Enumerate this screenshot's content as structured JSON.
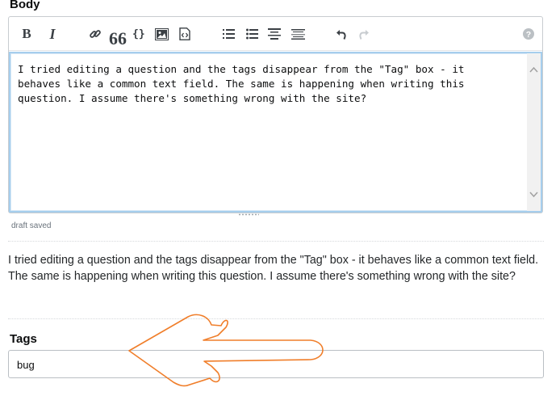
{
  "body_label": "Body",
  "toolbar": {
    "bold_label": "B",
    "italic_label": "I",
    "quote_label": "66",
    "code_label": "{}",
    "icons": [
      "bold-icon",
      "italic-icon",
      "link-icon",
      "blockquote-icon",
      "code-icon",
      "image-icon",
      "snippet-icon",
      "ordered-list-icon",
      "bulleted-list-icon",
      "heading-icon",
      "horizontal-rule-icon",
      "undo-icon",
      "redo-icon",
      "help-icon"
    ]
  },
  "editor": {
    "text": "I tried editing a question and the tags disappear from the \"Tag\" box - it\nbehaves like a common text field. The same is happening when writing this\nquestion. I assume there's something wrong with the site?"
  },
  "draft_status": "draft saved",
  "preview": {
    "text": "I tried editing a question and the tags disappear from the \"Tag\" box - it behaves like a common text field. The same is happening when writing this question. I assume there's something wrong with the site?"
  },
  "tags": {
    "label": "Tags",
    "value": "bug"
  },
  "colors": {
    "focus_border": "#a6ceed",
    "annotation_arrow": "#f07e2a"
  }
}
